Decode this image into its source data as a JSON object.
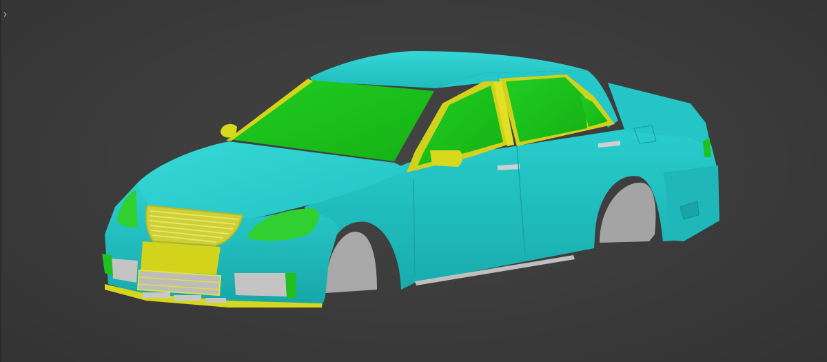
{
  "viewport": {
    "background": "#3c3c3c",
    "panel_toggle_icon": "chevron-right-icon"
  },
  "model": {
    "body_color": "#22c9c9",
    "glass_color": "#1fbf1f",
    "trim_color": "#d8d81c",
    "lamp_color": "#2ed12e",
    "wheel_well_color": "#a9a9a9",
    "chrome_color": "#c8c8c8"
  }
}
